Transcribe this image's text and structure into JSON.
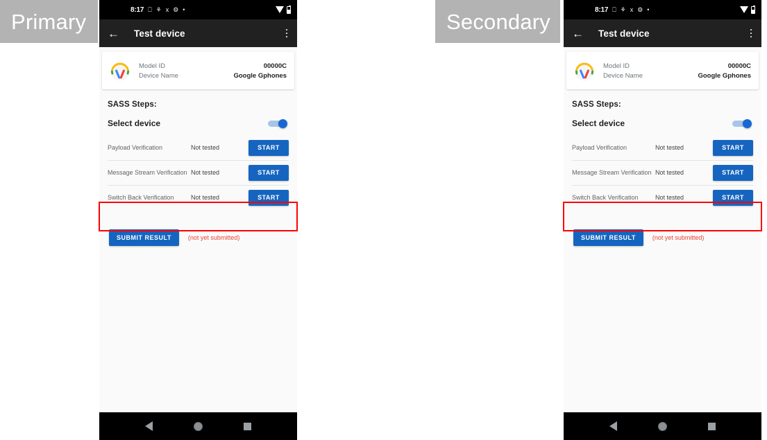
{
  "annotations": {
    "primary_label": "Primary",
    "secondary_label": "Secondary"
  },
  "colors": {
    "accent_blue": "#1565c0",
    "toggle_on": "#1967d2",
    "error_red": "#ea4335",
    "highlight_red": "#ff0000",
    "appbar_dark": "#212121",
    "screen_bg": "#fafafa",
    "annotation_gray": "#b3b3b3"
  },
  "phone": {
    "status_bar": {
      "time": "8:17",
      "icons": [
        "sim-card-icon",
        "bug-icon",
        "vpn-key-icon",
        "developer-mode-icon",
        "dot-icon"
      ],
      "right_icons": [
        "wifi-icon",
        "battery-icon"
      ]
    },
    "app_bar": {
      "back_icon": "back-arrow-icon",
      "title": "Test device",
      "overflow_icon": "overflow-menu-icon"
    },
    "device_card": {
      "icon": "headphones-icon",
      "rows": [
        {
          "key": "Model ID",
          "value": "00000C"
        },
        {
          "key": "Device Name",
          "value": "Google Gphones"
        }
      ]
    },
    "sass": {
      "title": "SASS Steps:",
      "select_device_label": "Select device",
      "toggle_state": "on",
      "steps": [
        {
          "name": "Payload Verification",
          "status": "Not tested",
          "action": "START"
        },
        {
          "name": "Message Stream Verification",
          "status": "Not tested",
          "action": "START"
        },
        {
          "name": "Switch Back Verification",
          "status": "Not tested",
          "action": "START"
        }
      ]
    },
    "submit": {
      "button_label": "SUBMIT RESULT",
      "note": "(not yet submitted)"
    },
    "nav_bar": {
      "back_icon": "nav-back-icon",
      "home_icon": "nav-home-icon",
      "recents_icon": "nav-recents-icon"
    }
  }
}
